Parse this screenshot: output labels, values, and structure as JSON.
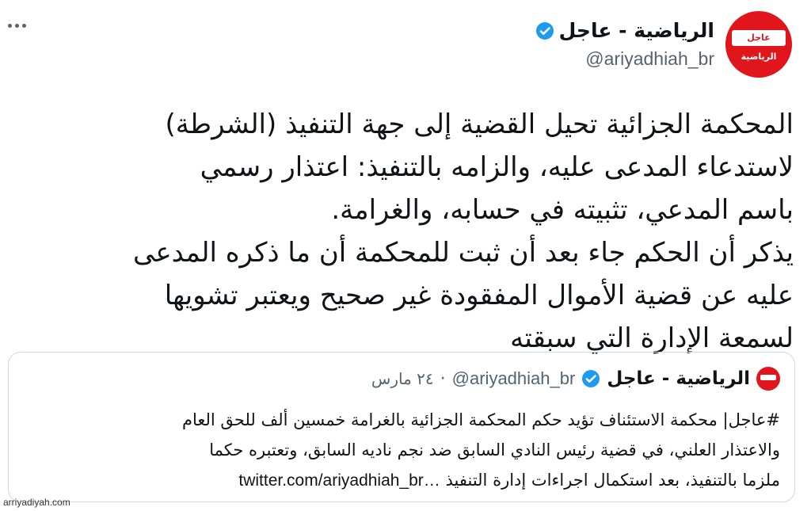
{
  "tweet": {
    "author": {
      "display_name": "الرياضية - عاجل",
      "handle": "@ariyadhiah_br",
      "verified": true,
      "avatar_top_text": "عاجل",
      "avatar_bottom_text": "الرياضية"
    },
    "text": "المحكمة الجزائية تحيل القضية إلى جهة التنفيذ (الشرطة)\nلاستدعاء المدعى عليه، والزامه بالتنفيذ: اعتذار رسمي\nباسم المدعي، تثبيته في حسابه، والغرامة.\nيذكر أن الحكم جاء بعد أن ثبت للمحكمة أن ما ذكره المدعى\nعليه عن قضية الأموال المفقودة غير صحيح ويعتبر تشويها\nلسمعة الإدارة التي سبقته"
  },
  "quoted_tweet": {
    "display_name": "الرياضية - عاجل",
    "handle": "@ariyadhiah_br",
    "separator": "·",
    "date": "٢٤ مارس",
    "text": "#عاجل| محكمة الاستئناف تؤيد حكم المحكمة الجزائية بالغرامة خمسين ألف للحق العام\nوالاعتذار العلني، في قضية رئيس النادي السابق ضد نجم ناديه السابق، وتعتبره حكما\nملزما بالتنفيذ، بعد استكمال اجراءات إدارة التنفيذ",
    "link": "twitter.com/ariyadhiah_br…"
  },
  "watermark": "arriyadiyah.com",
  "colors": {
    "verified": "#1d9bf0",
    "brand_red": "#e0161c",
    "secondary_text": "#536471",
    "border": "#cfd9de"
  },
  "icons": {
    "more": "more-dots-icon",
    "verified": "verified-badge-icon"
  }
}
